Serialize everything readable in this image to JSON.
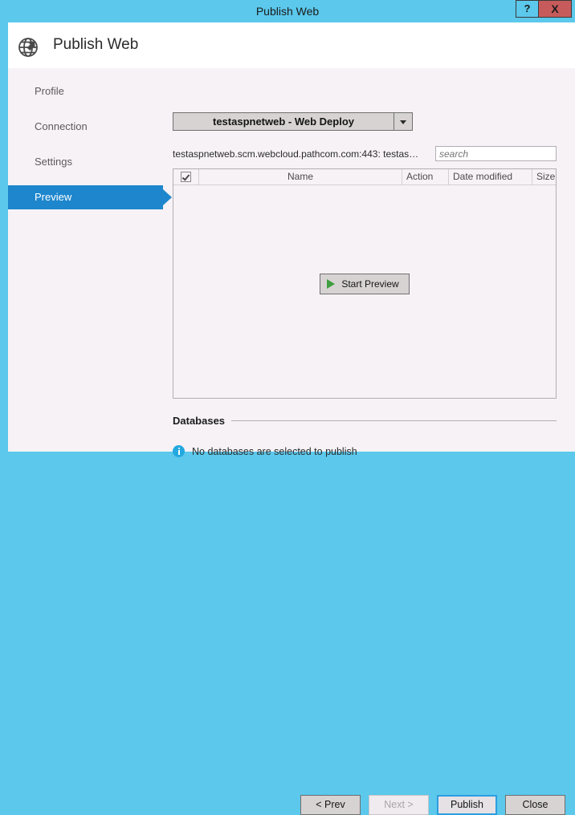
{
  "window": {
    "title": "Publish Web",
    "help_label": "?",
    "close_label": "X",
    "titlebar_color": "#5bc8ec"
  },
  "header": {
    "title": "Publish Web",
    "icon": "globe-publish-icon"
  },
  "sidebar": {
    "items": [
      {
        "label": "Profile",
        "selected": false
      },
      {
        "label": "Connection",
        "selected": false
      },
      {
        "label": "Settings",
        "selected": false
      },
      {
        "label": "Preview",
        "selected": true
      }
    ],
    "selected_color": "#1d86cd"
  },
  "main": {
    "profile_dropdown": {
      "value": "testaspnetweb - Web Deploy",
      "icon": "chevron-down-icon"
    },
    "connection_url": "testaspnetweb.scm.webcloud.pathcom.com:443: testas…",
    "search": {
      "value": "",
      "placeholder": "search"
    },
    "file_list": {
      "select_all_checked": true,
      "columns": [
        {
          "key": "check",
          "label": ""
        },
        {
          "key": "name",
          "label": "Name"
        },
        {
          "key": "action",
          "label": "Action"
        },
        {
          "key": "date",
          "label": "Date modified"
        },
        {
          "key": "size",
          "label": "Size"
        }
      ],
      "rows": [],
      "start_preview_label": "Start Preview"
    },
    "databases": {
      "section_title": "Databases",
      "message": "No databases are selected to publish",
      "message_icon": "info-icon",
      "info_color": "#23a8e0"
    }
  },
  "footer": {
    "buttons": [
      {
        "label": "< Prev",
        "state": "enabled"
      },
      {
        "label": "Next >",
        "state": "disabled"
      },
      {
        "label": "Publish",
        "state": "default"
      },
      {
        "label": "Close",
        "state": "enabled"
      }
    ]
  }
}
